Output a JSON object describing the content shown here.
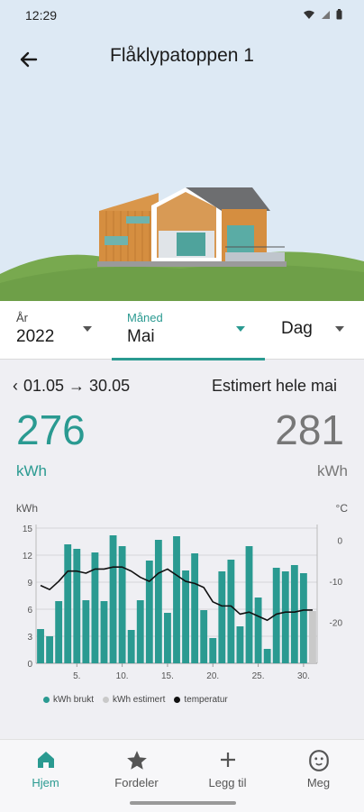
{
  "status": {
    "time": "12:29"
  },
  "header": {
    "title": "Flåklypatoppen 1"
  },
  "periods": [
    {
      "label": "År",
      "value": "2022"
    },
    {
      "label": "Måned",
      "value": "Mai"
    },
    {
      "label": "",
      "value": "Dag"
    }
  ],
  "summary": {
    "range": "01.05 → 30.05",
    "estimate_title": "Estimert hele mai",
    "used_value": "276",
    "used_unit": "kWh",
    "estimated_value": "281",
    "estimated_unit": "kWh"
  },
  "colors": {
    "accent": "#2a9a91",
    "estimated": "#c9c9c9",
    "temperature": "#111111"
  },
  "chart_data": {
    "type": "bar",
    "ylabel_left": "kWh",
    "ylabel_right": "°C",
    "left_ticks": [
      "15",
      "12",
      "9",
      "6",
      "3",
      "0"
    ],
    "right_ticks": [
      "0",
      "-10",
      "-20"
    ],
    "ylim": [
      0,
      15
    ],
    "y2lim": [
      -30,
      3
    ],
    "x_tick_labels": [
      "5.",
      "10.",
      "15.",
      "20.",
      "25.",
      "30."
    ],
    "x_tick_days": [
      5,
      10,
      15,
      20,
      25,
      30
    ],
    "days": [
      1,
      2,
      3,
      4,
      5,
      6,
      7,
      8,
      9,
      10,
      11,
      12,
      13,
      14,
      15,
      16,
      17,
      18,
      19,
      20,
      21,
      22,
      23,
      24,
      25,
      26,
      27,
      28,
      29,
      30,
      31
    ],
    "series": [
      {
        "name": "kWh brukt",
        "values": [
          3.8,
          3.0,
          6.9,
          13.2,
          12.7,
          7.0,
          12.3,
          6.9,
          14.2,
          13.0,
          3.7,
          7.0,
          11.4,
          13.7,
          5.6,
          14.1,
          10.3,
          12.2,
          5.9,
          2.8,
          10.2,
          11.5,
          4.1,
          13.0,
          7.3,
          1.6,
          10.6,
          10.2,
          10.9,
          10.0,
          0
        ]
      },
      {
        "name": "kWh estimert",
        "values": [
          0,
          0,
          0,
          0,
          0,
          0,
          0,
          0,
          0,
          0,
          0,
          0,
          0,
          0,
          0,
          0,
          0,
          0,
          0,
          0,
          0,
          0,
          0,
          0,
          0,
          0,
          0,
          0,
          0,
          0,
          5.8
        ]
      },
      {
        "name": "temperatur",
        "values": [
          -11,
          -12,
          -10,
          -7.5,
          -7.5,
          -8,
          -7,
          -7,
          -6.5,
          -6.5,
          -7.5,
          -9,
          -10,
          -8,
          -7,
          -8.5,
          -10,
          -10.5,
          -11.5,
          -15,
          -16,
          -16,
          -18,
          -17.5,
          -18.5,
          -19.5,
          -18,
          -17.5,
          -17.5,
          -17,
          -17
        ]
      }
    ]
  },
  "nav": [
    {
      "label": "Hjem",
      "icon": "home-icon"
    },
    {
      "label": "Fordeler",
      "icon": "star-icon"
    },
    {
      "label": "Legg til",
      "icon": "plus-icon"
    },
    {
      "label": "Meg",
      "icon": "face-icon"
    }
  ]
}
